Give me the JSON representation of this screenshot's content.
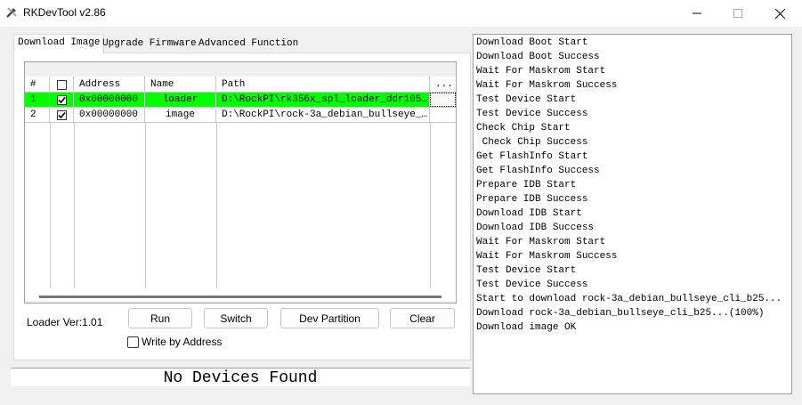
{
  "window": {
    "title": "RKDevTool v2.86"
  },
  "tabs": [
    {
      "label": "Download Image"
    },
    {
      "label": "Upgrade Firmware"
    },
    {
      "label": "Advanced Function"
    }
  ],
  "table": {
    "headers": [
      "#",
      "Address",
      "Name",
      "Path",
      "..."
    ],
    "rows": [
      {
        "index": "1",
        "checked": true,
        "address": "0x00000000",
        "name": "loader",
        "path": "D:\\RockPI\\rk356x_spl_loader_ddr1056..."
      },
      {
        "index": "2",
        "checked": true,
        "address": "0x00000000",
        "name": "image",
        "path": "D:\\RockPI\\rock-3a_debian_bullseye_c..."
      }
    ]
  },
  "controls": {
    "loader_version": "Loader Ver:1.01",
    "run": "Run",
    "switch": "Switch",
    "dev_partition": "Dev Partition",
    "clear": "Clear",
    "write_by_address": "Write by Address"
  },
  "status": "No Devices Found",
  "log": [
    "Download Boot Start",
    "Download Boot Success",
    "Wait For Maskrom Start",
    "Wait For Maskrom Success",
    "Test Device Start",
    "Test Device Success",
    "Check Chip Start",
    " Check Chip Success",
    "Get FlashInfo Start",
    "Get FlashInfo Success",
    "Prepare IDB Start",
    "Prepare IDB Success",
    "Download IDB Start",
    "Download IDB Success",
    "Wait For Maskrom Start",
    "Wait For Maskrom Success",
    "Test Device Start",
    "Test Device Success",
    "Start to download rock-3a_debian_bullseye_cli_b25...",
    "Download rock-3a_debian_bullseye_cli_b25...(100%)",
    "Download image OK"
  ],
  "colors": {
    "selected_row": "#00ff00"
  }
}
